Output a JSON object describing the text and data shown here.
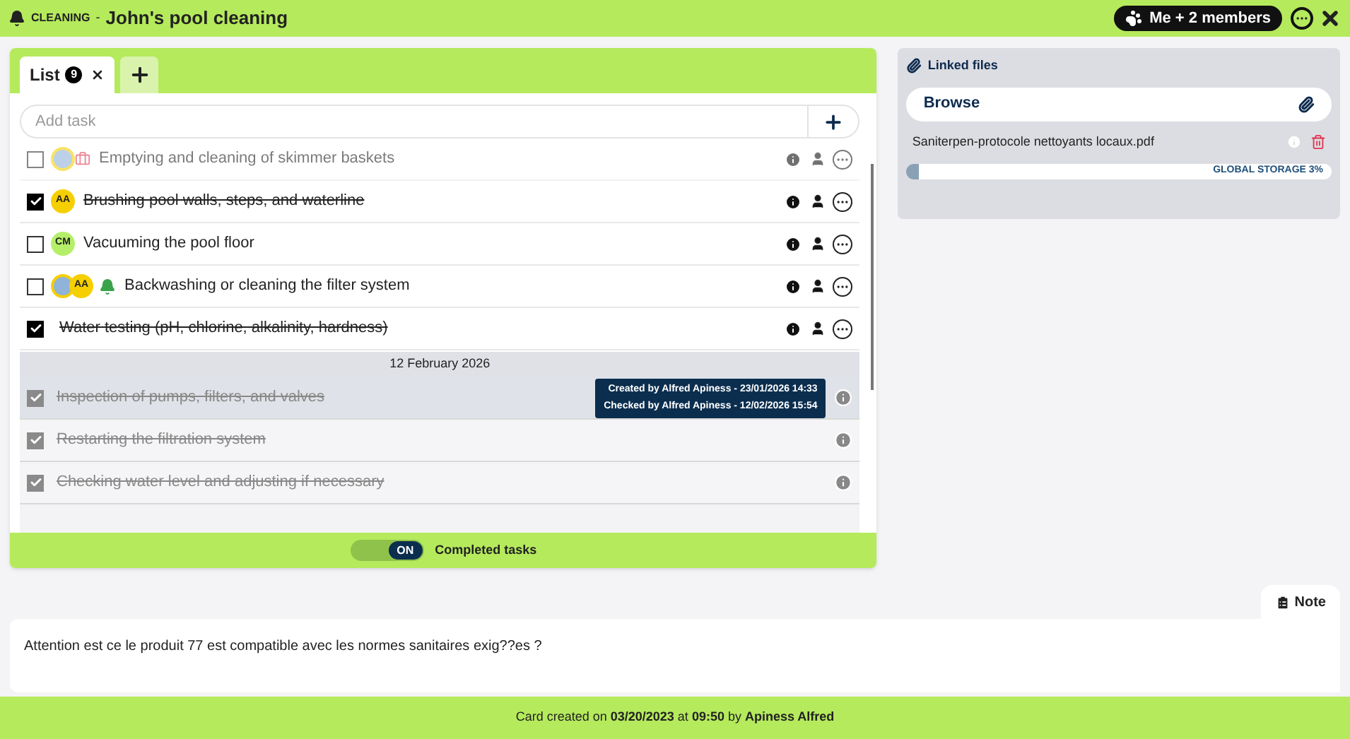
{
  "header": {
    "category": "CLEANING",
    "separator": "-",
    "title": "John's pool cleaning",
    "members": "Me + 2 members"
  },
  "tabs": [
    {
      "label": "List",
      "count": "9",
      "selected": true
    }
  ],
  "add_task": {
    "placeholder": "Add task"
  },
  "tasks": [
    {
      "text": "Emptying and cleaning of skimmer baskets",
      "checked": false,
      "faded": true,
      "avatars": [
        {
          "kind": "photo"
        }
      ]
    },
    {
      "text": "Brushing pool walls, steps, and waterline",
      "checked": true,
      "faded": false,
      "avatars": [
        {
          "kind": "initials",
          "initials": "AA",
          "color": "#f5cf00"
        }
      ]
    },
    {
      "text": "Vacuuming the pool floor",
      "checked": false,
      "faded": false,
      "avatars": [
        {
          "kind": "initials",
          "initials": "CM",
          "color": "#b5ef6a"
        }
      ]
    },
    {
      "text": "Backwashing or cleaning the filter system",
      "checked": false,
      "faded": false,
      "avatars": [
        {
          "kind": "photo"
        },
        {
          "kind": "initials",
          "initials": "AA",
          "color": "#f5cf00"
        }
      ]
    },
    {
      "text": "Water testing (pH, chlorine, alkalinity, hardness)",
      "checked": true,
      "faded": false
    }
  ],
  "completed": {
    "date": "12 February 2026",
    "tasks": [
      {
        "text": "Inspection of pumps, filters, and valves",
        "checked": true,
        "selected": true,
        "tooltip": [
          "Created by Alfred Apiness - 23/01/2026 14:33",
          "Checked by Alfred Apiness - 12/02/2026 15:54"
        ]
      },
      {
        "text": "Restarting the filtration system",
        "checked": true,
        "selected": false
      },
      {
        "text": "Checking water level and adjusting if necessary",
        "checked": true,
        "selected": false
      }
    ]
  },
  "completed_toggle": {
    "on": true,
    "state_label": "ON",
    "label": "Completed tasks"
  },
  "linked_files": {
    "title": "Linked files",
    "browse": "Browse",
    "files": [
      {
        "name": "Saniterpen-protocole nettoyants locaux.pdf"
      }
    ],
    "storage": {
      "label": "GLOBAL STORAGE 3%",
      "level": 0.03
    }
  },
  "note": {
    "label": "Note",
    "text": "Attention est ce le produit 77 est compatible avec les normes sanitaires exig??es ?"
  },
  "footer": {
    "text": "Card created on **03/20/2023** at **09:50** by **Apiness Alfred**"
  }
}
